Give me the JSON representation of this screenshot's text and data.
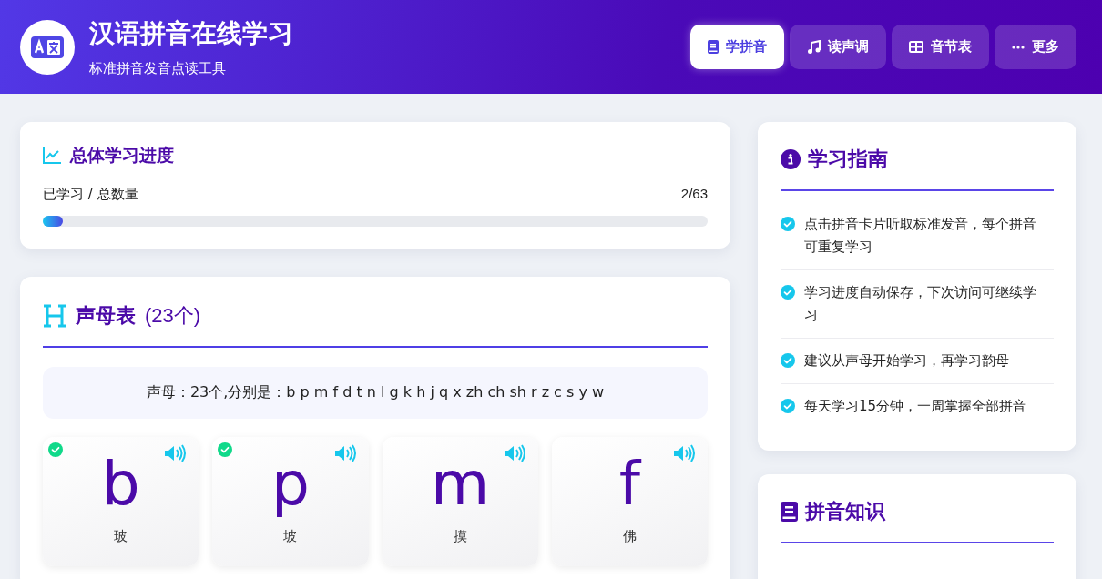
{
  "header": {
    "title": "汉语拼音在线学习",
    "subtitle": "标准拼音发音点读工具"
  },
  "nav": [
    {
      "label": "学拼音",
      "kind": "book",
      "selected": true
    },
    {
      "label": "读声调",
      "kind": "music",
      "selected": false
    },
    {
      "label": "音节表",
      "kind": "table",
      "selected": false
    },
    {
      "label": "更多",
      "kind": "more",
      "selected": false
    }
  ],
  "progress": {
    "title": "总体学习进度",
    "label": "已学习 / 总数量",
    "count": "2/63",
    "level": 0.03
  },
  "initials": {
    "title": "声母表",
    "count": "(23个)",
    "intro": "声母：23个,分别是：b p m f d t n l g k h j q x zh ch sh r z c s y w",
    "cards": [
      {
        "letter": "b",
        "hanzi": "玻",
        "learned": true
      },
      {
        "letter": "p",
        "hanzi": "坡",
        "learned": true
      },
      {
        "letter": "m",
        "hanzi": "摸",
        "learned": false
      },
      {
        "letter": "f",
        "hanzi": "佛",
        "learned": false
      }
    ]
  },
  "guide": {
    "title": "学习指南",
    "items": [
      "点击拼音卡片听取标准发音，每个拼音可重复学习",
      "学习进度自动保存，下次访问可继续学习",
      "建议从声母开始学习，再学习韵母",
      "每天学习15分钟，一周掌握全部拼音"
    ]
  },
  "knowledge": {
    "title": "拼音知识"
  }
}
